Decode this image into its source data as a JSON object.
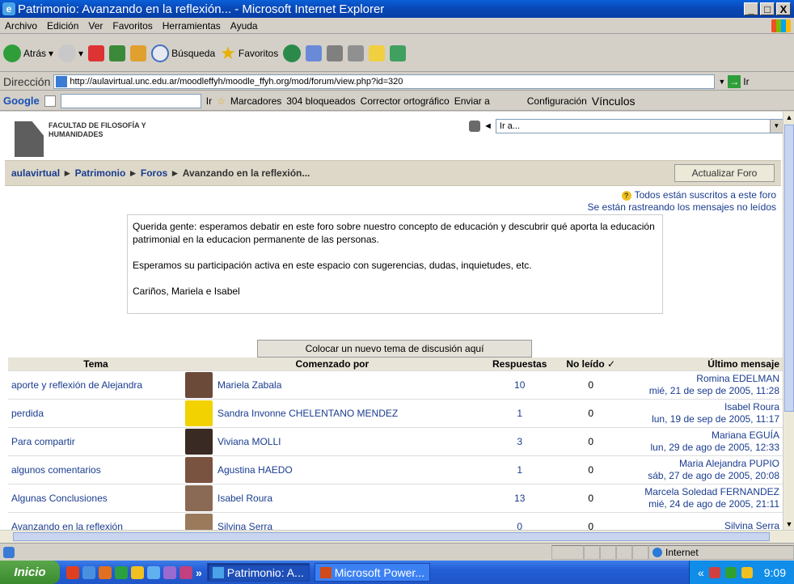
{
  "window": {
    "title": "Patrimonio: Avanzando en la reflexión... - Microsoft Internet Explorer",
    "buttons": [
      "_",
      "□",
      "X"
    ]
  },
  "menu": [
    "Archivo",
    "Edición",
    "Ver",
    "Favoritos",
    "Herramientas",
    "Ayuda"
  ],
  "toolbar": {
    "back": "Atrás",
    "search": "Búsqueda",
    "favorites": "Favoritos"
  },
  "address": {
    "label": "Dirección",
    "url": "http://aulavirtual.unc.edu.ar/moodleffyh/moodle_ffyh.org/mod/forum/view.php?id=320",
    "go": "Ir"
  },
  "googlebar": {
    "logo": "Google",
    "go": "Ir",
    "bookmarks": "Marcadores",
    "blocked": "304 bloqueados",
    "spell": "Corrector ortográfico",
    "send": "Enviar a",
    "settings": "Configuración",
    "links": "Vínculos"
  },
  "site": {
    "logo_line1": "FACULTAD DE FILOSOFÍA Y",
    "logo_line2": "HUMANIDADES",
    "jump_placeholder": "Ir a..."
  },
  "breadcrumb": {
    "home": "aulavirtual",
    "course": "Patrimonio",
    "forums": "Foros",
    "current": "Avanzando en la reflexión...",
    "sep": "►"
  },
  "update_button": "Actualizar Foro",
  "subscription": {
    "line1": "Todos están suscritos a este foro",
    "line2": "Se están rastreando los mensajes no leídos"
  },
  "intro": {
    "p1": "Querida gente: esperamos debatir en este foro sobre nuestro concepto de educación y descubrir qué aporta la educación patrimonial en la educacion permanente de las personas.",
    "p2": "Esperamos su participación activa en este espacio con sugerencias, dudas, inquietudes, etc.",
    "p3": "Cariños, Mariela e Isabel"
  },
  "new_topic_button": "Colocar un nuevo tema de discusión aquí",
  "table": {
    "headers": [
      "Tema",
      "Comenzado por",
      "Respuestas",
      "No leído ✓",
      "Último mensaje"
    ],
    "rows": [
      {
        "topic": "aporte y reflexión de Alejandra",
        "author": "Mariela Zabala",
        "replies": "10",
        "unread": "0",
        "last_user": "Romina EDELMAN",
        "last_date": "mié, 21 de sep de 2005, 11:28",
        "avatar_color": "#6b4a3a"
      },
      {
        "topic": "perdida",
        "author": "Sandra Invonne CHELENTANO MENDEZ",
        "replies": "1",
        "unread": "0",
        "last_user": "Isabel Roura",
        "last_date": "lun, 19 de sep de 2005, 11:17",
        "avatar_color": "#f2d200"
      },
      {
        "topic": "Para compartir",
        "author": "Viviana MOLLI",
        "replies": "3",
        "unread": "0",
        "last_user": "Mariana EGUÍA",
        "last_date": "lun, 29 de ago de 2005, 12:33",
        "avatar_color": "#3a2a24"
      },
      {
        "topic": "algunos comentarios",
        "author": "Agustina HAEDO",
        "replies": "1",
        "unread": "0",
        "last_user": "Maria Alejandra PUPIO",
        "last_date": "sáb, 27 de ago de 2005, 20:08",
        "avatar_color": "#7a5240"
      },
      {
        "topic": "Algunas Conclusiones",
        "author": "Isabel Roura",
        "replies": "13",
        "unread": "0",
        "last_user": "Marcela Soledad FERNANDEZ",
        "last_date": "mié, 24 de ago de 2005, 21:11",
        "avatar_color": "#8a6a55"
      },
      {
        "topic": "Avanzando en la reflexión",
        "author": "Silvina Serra",
        "replies": "0",
        "unread": "0",
        "last_user": "Silvina Serra",
        "last_date": "",
        "avatar_color": "#9a7a5a"
      }
    ]
  },
  "status": {
    "zone": "Internet"
  },
  "taskbar": {
    "start": "Inicio",
    "items": [
      "Patrimonio: A...",
      "Microsoft Power..."
    ],
    "clock": "9:09"
  }
}
